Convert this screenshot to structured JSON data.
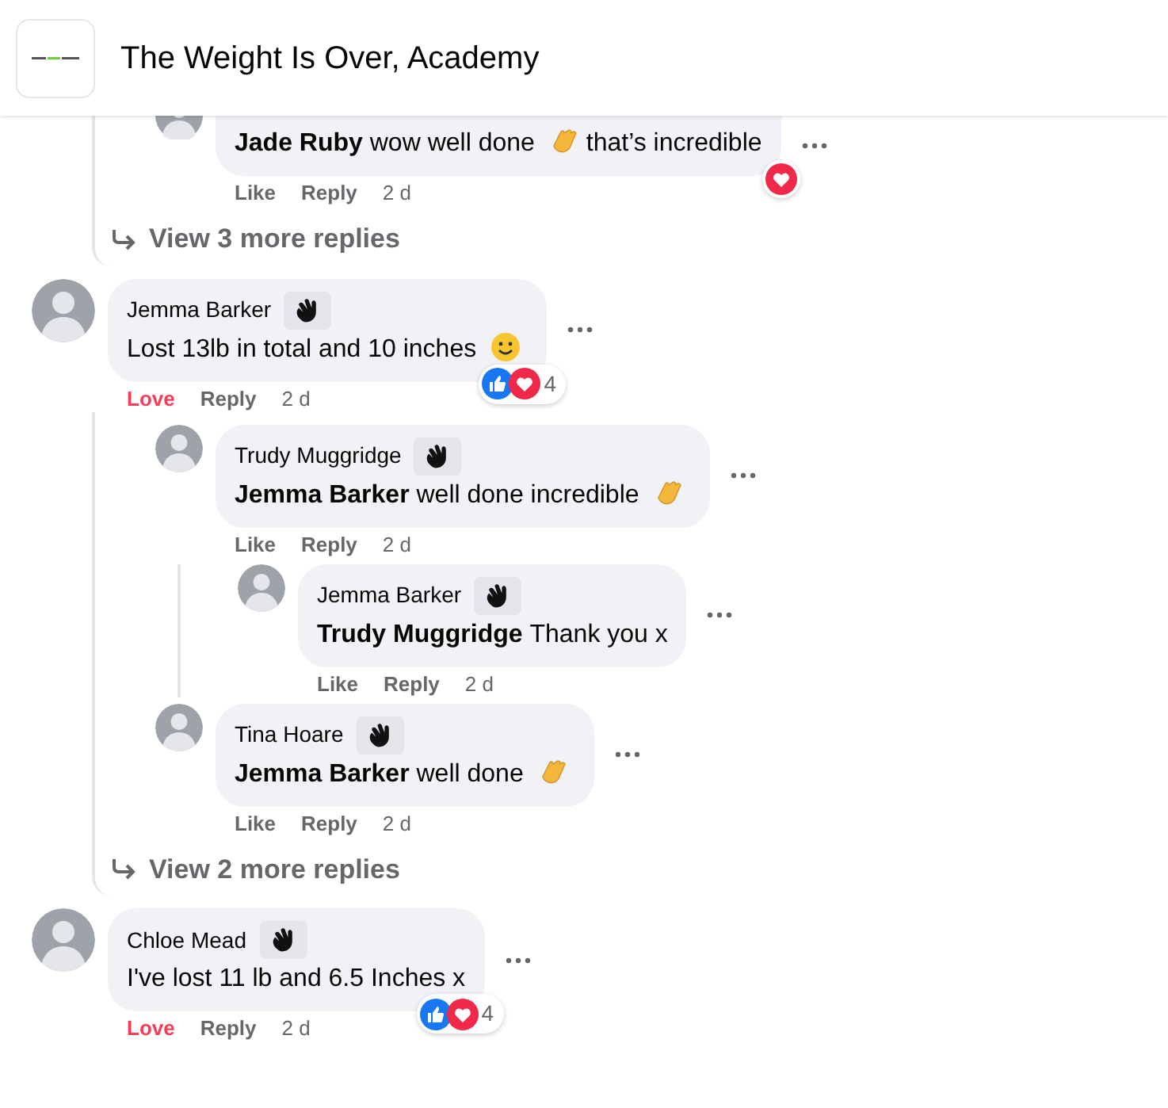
{
  "header": {
    "title": "The Weight Is Over, Academy"
  },
  "threads": [
    {
      "replies": [
        {
          "segments": [
            {
              "kind": "mention",
              "text": "Jade Ruby"
            },
            {
              "kind": "text",
              "text": "wow well done"
            },
            {
              "kind": "clap_emoji"
            },
            {
              "kind": "text",
              "text": "that’s incredible"
            }
          ],
          "reactions": {
            "types": [
              {
                "kind": "love"
              }
            ]
          },
          "reaction_label": "Like",
          "reacted": false,
          "reply_label": "Reply",
          "time": "2 d"
        }
      ],
      "more_replies": "View 3 more replies"
    },
    {
      "author": "Jemma Barker",
      "segments": [
        {
          "kind": "text",
          "text": "Lost 13lb in total and 10 inches"
        },
        {
          "kind": "smile_emoji"
        }
      ],
      "reactions": {
        "types": [
          {
            "kind": "like"
          },
          {
            "kind": "love"
          }
        ],
        "count": "4"
      },
      "reaction_label": "Love",
      "reacted": true,
      "reply_label": "Reply",
      "time": "2 d",
      "replies": [
        {
          "author": "Trudy Muggridge",
          "segments": [
            {
              "kind": "mention",
              "text": "Jemma Barker"
            },
            {
              "kind": "text",
              "text": "well done incredible"
            },
            {
              "kind": "clap_emoji"
            }
          ],
          "reaction_label": "Like",
          "reacted": false,
          "reply_label": "Reply",
          "time": "2 d",
          "replies": [
            {
              "author": "Jemma Barker",
              "segments": [
                {
                  "kind": "mention",
                  "text": "Trudy Muggridge"
                },
                {
                  "kind": "text",
                  "text": "Thank you x"
                }
              ],
              "reaction_label": "Like",
              "reacted": false,
              "reply_label": "Reply",
              "time": "2 d"
            }
          ]
        },
        {
          "author": "Tina Hoare",
          "segments": [
            {
              "kind": "mention",
              "text": "Jemma Barker"
            },
            {
              "kind": "text",
              "text": "well done"
            },
            {
              "kind": "clap_emoji"
            }
          ],
          "reaction_label": "Like",
          "reacted": false,
          "reply_label": "Reply",
          "time": "2 d"
        }
      ],
      "more_replies": "View 2 more replies"
    },
    {
      "author": "Chloe Mead",
      "segments": [
        {
          "kind": "text",
          "text": "I've lost 11 lb and 6.5 Inches x"
        }
      ],
      "reactions": {
        "types": [
          {
            "kind": "like"
          },
          {
            "kind": "love"
          }
        ],
        "count": "4"
      },
      "reaction_label": "Love",
      "reacted": true,
      "reply_label": "Reply",
      "time": "2 d"
    }
  ]
}
